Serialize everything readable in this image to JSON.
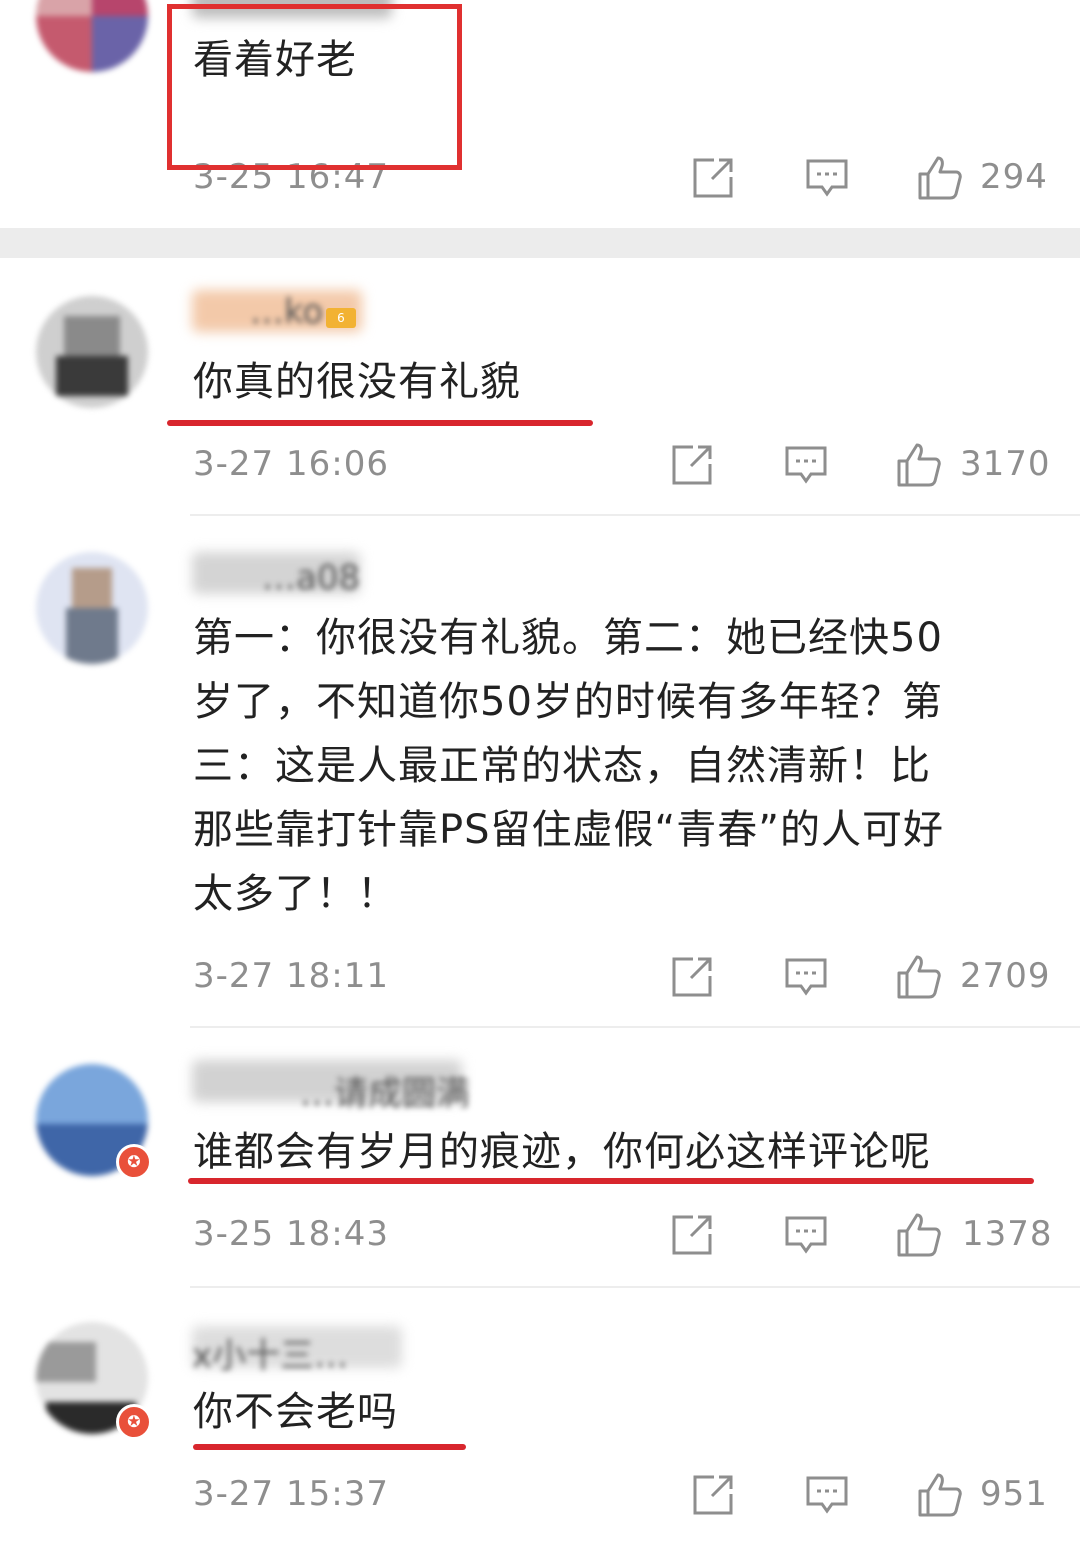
{
  "comments": [
    {
      "content": "看着好老",
      "timestamp": "3-25 16:47",
      "likes": "294"
    },
    {
      "username": "…ko",
      "content": "你真的很没有礼貌",
      "timestamp": "3-27 16:06",
      "likes": "3170"
    },
    {
      "username": "…a08",
      "content": "第一：你很没有礼貌。第二：她已经快50\n岁了，不知道你50岁的时候有多年轻？第\n三：这是人最正常的状态，自然清新！比\n那些靠打针靠PS留住虚假“青春”的人可好\n太多了！！",
      "timestamp": "3-27 18:11",
      "likes": "2709"
    },
    {
      "username": "…请成圆满",
      "content": "谁都会有岁月的痕迹，你何必这样评论呢",
      "timestamp": "3-25 18:43",
      "likes": "1378"
    },
    {
      "username": "x小十三…",
      "content": "你不会老吗",
      "timestamp": "3-27 15:37",
      "likes": "951"
    }
  ],
  "icons": {
    "share": "share-icon",
    "reply": "comment-icon",
    "like": "thumbs-up-icon"
  },
  "colors": {
    "highlight": "#e03030",
    "meta_text": "#8e8e8e",
    "divider": "#ededed"
  }
}
